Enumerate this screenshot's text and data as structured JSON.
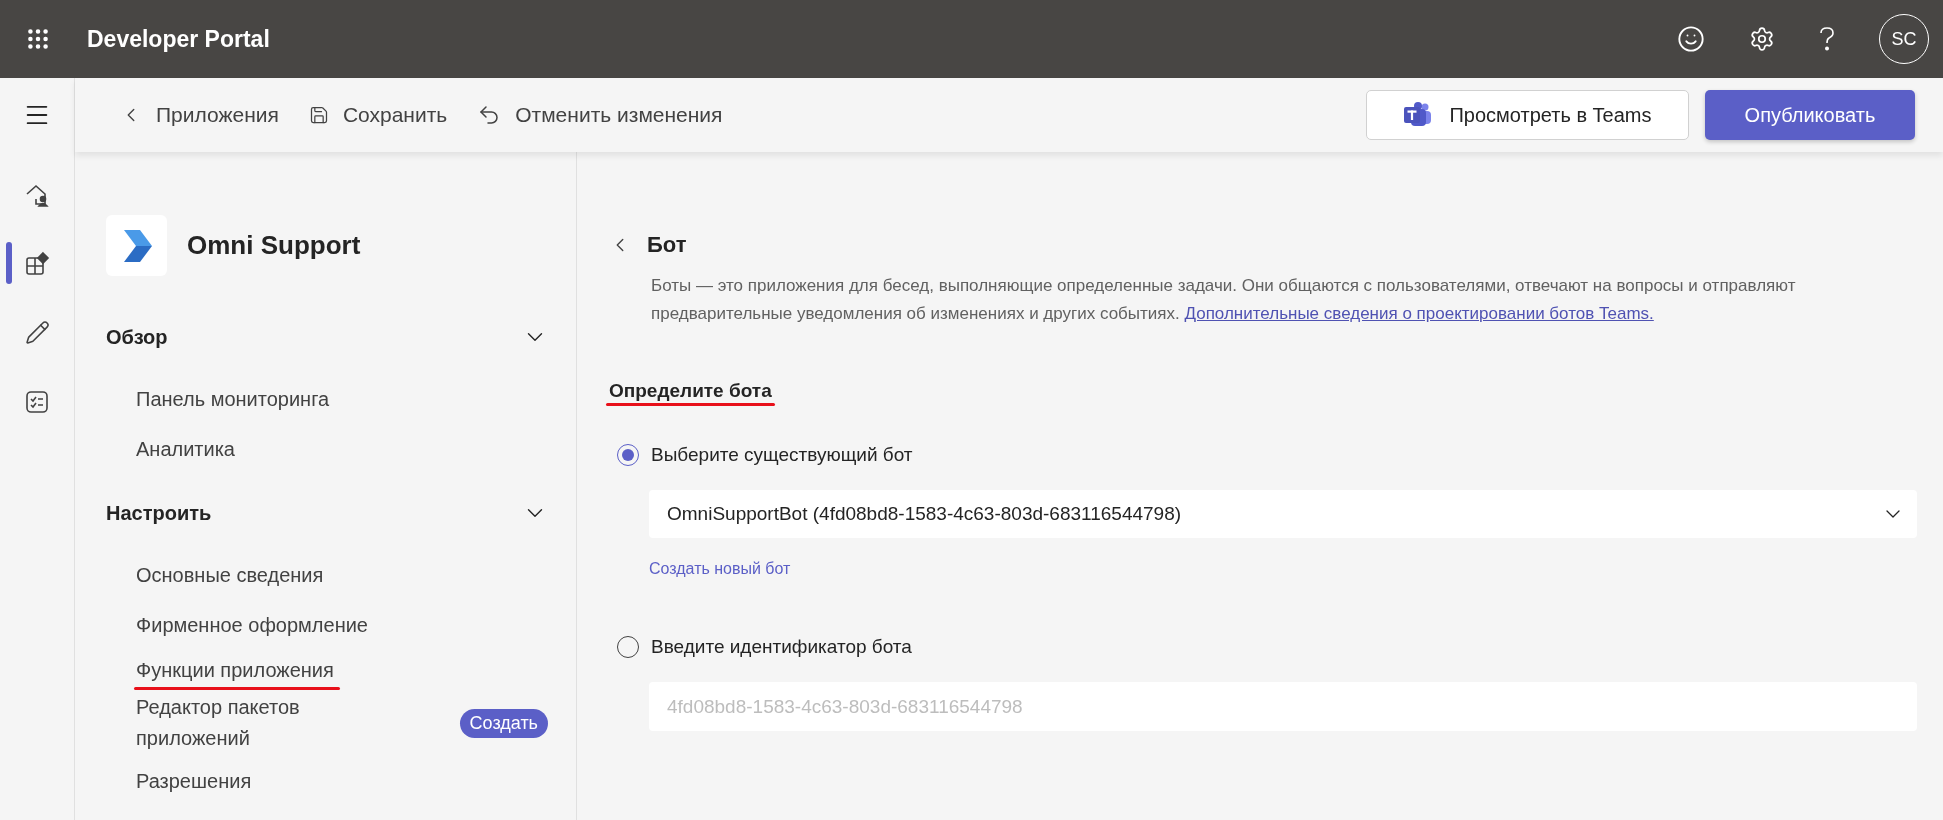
{
  "app_bar": {
    "title": "Developer Portal",
    "avatar": "SC"
  },
  "toolbar": {
    "items": [
      {
        "kind": "back",
        "label": "Приложения"
      },
      {
        "kind": "save",
        "label": "Сохранить"
      },
      {
        "kind": "undo",
        "label": "Отменить изменения"
      }
    ],
    "teams_button": "Просмотреть в Teams",
    "publish_button": "Опубликовать"
  },
  "rail": {
    "items": [
      {
        "kind": "home",
        "selected": false
      },
      {
        "kind": "apps",
        "selected": true
      },
      {
        "kind": "edit",
        "selected": false
      },
      {
        "kind": "tasks",
        "selected": false
      }
    ]
  },
  "sidebar": {
    "app_name": "Omni Support",
    "sections": [
      {
        "title": "Обзор",
        "expanded": true,
        "children": [
          {
            "label": "Панель мониторинга",
            "underlined": false
          },
          {
            "label": "Аналитика",
            "underlined": false
          }
        ]
      },
      {
        "title": "Настроить",
        "expanded": true,
        "children": [
          {
            "label": "Основные сведения",
            "underlined": false
          },
          {
            "label": "Фирменное оформление",
            "underlined": false
          },
          {
            "label": "Функции приложения",
            "underlined": true
          },
          {
            "label": "Редактор пакетов приложений",
            "underlined": false,
            "badge": "Создать"
          },
          {
            "label": "Разрешения",
            "underlined": false
          }
        ]
      }
    ]
  },
  "content": {
    "title": "Бот",
    "description": "Боты — это приложения для бесед, выполняющие определенные задачи. Они общаются с пользователями, отвечают на вопросы и отправляют предварительные уведомления об изменениях и других событиях.",
    "link": "Дополнительные сведения о проектировании ботов Teams.",
    "section_title": "Определите бота",
    "section_underlined": true,
    "options": [
      {
        "kind": "dropdown",
        "label": "Выберите существующий бот",
        "selected": true,
        "value": "OmniSupportBot (4fd08bd8-1583-4c63-803d-683116544798)",
        "link": "Создать новый бот"
      },
      {
        "kind": "input",
        "label": "Введите идентификатор бота",
        "selected": false,
        "placeholder": "4fd08bd8-1583-4c63-803d-683116544798"
      }
    ]
  }
}
